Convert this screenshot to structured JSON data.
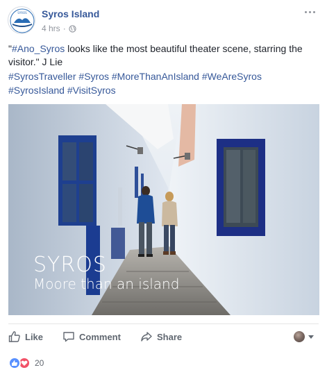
{
  "post": {
    "page_name": "Syros Island",
    "time": "4 hrs",
    "separator": "·",
    "privacy_icon": "globe-icon",
    "more_icon": "ellipsis-icon",
    "avatar_logo": "syros-island-logo",
    "text_line": "\"#Ano_Syros looks like the most beautiful theater scene, starring the visitor.\" J Lie",
    "hashtag_link": "#Ano_Syros",
    "text_rest": " looks like the most beautiful theater scene, starring the visitor.\" J Lie",
    "text_open_quote": "\"",
    "hashtags": [
      "#SyrosTraveller",
      "#Syros",
      "#MoreThanAnIsland",
      "#WeAreSyros",
      "#SyrosIsland",
      "#VisitSyros"
    ]
  },
  "photo": {
    "description_icon": "photo-alley",
    "caption_line1": "SYROS",
    "caption_line2": "Moore than an island"
  },
  "actions": {
    "like": "Like",
    "comment": "Comment",
    "share": "Share"
  },
  "reactions": {
    "count": "20",
    "types": [
      "like",
      "love"
    ]
  },
  "colors": {
    "link": "#365899",
    "meta": "#90949c",
    "action_text": "#606770",
    "like_blue": "#5890ff",
    "love_red": "#f25268"
  }
}
